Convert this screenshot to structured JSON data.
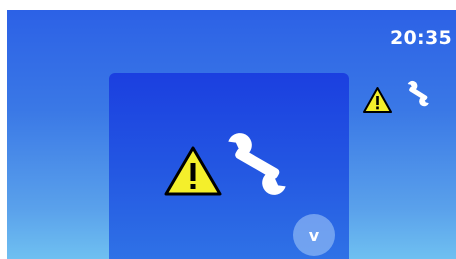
{
  "status_bar": {
    "time": "20:35",
    "icons": [
      "warning-icon",
      "wrench-icon"
    ]
  },
  "notification_card": {
    "icons": [
      "warning-icon",
      "wrench-icon"
    ],
    "expand_button_label": "v"
  },
  "colors": {
    "warning_fill": "#f4ef2b",
    "icon_white": "#ffffff",
    "card_background": "#2356e2"
  }
}
